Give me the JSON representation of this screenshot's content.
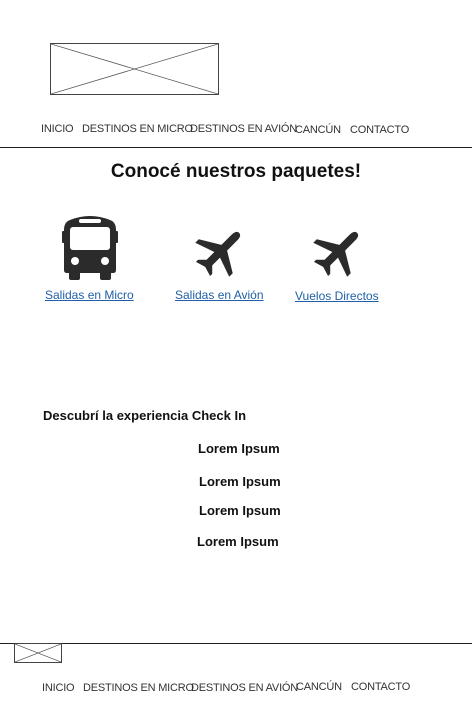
{
  "header": {
    "nav": [
      "INICIO",
      "DESTINOS EN MICRO",
      "DESTINOS EN AVIÓN",
      "CANCÚN",
      "CONTACTO"
    ]
  },
  "main": {
    "title": "Conocé nuestros paquetes!",
    "packages": [
      {
        "label": "Salidas en Micro",
        "icon": "bus-icon"
      },
      {
        "label": "Salidas en Avión",
        "icon": "airplane-icon"
      },
      {
        "label": "Vuelos Directos",
        "icon": "airplane-icon"
      }
    ],
    "subtitle": "Descubrí la experiencia Check In",
    "items": [
      "Lorem Ipsum",
      "Lorem Ipsum",
      "Lorem Ipsum",
      "Lorem Ipsum"
    ]
  },
  "footer": {
    "nav": [
      "INICIO",
      "DESTINOS EN MICRO",
      "DESTINOS EN AVIÓN",
      "CANCÚN",
      "CONTACTO"
    ]
  },
  "colors": {
    "link": "#1f5fa8",
    "icon": "#2b2b2b"
  }
}
